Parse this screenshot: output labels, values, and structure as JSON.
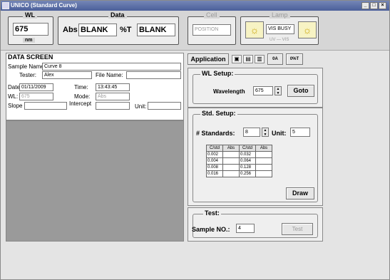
{
  "window": {
    "title": "UNICO (Standard Curve)",
    "controls": [
      "_",
      "□",
      "×"
    ]
  },
  "top": {
    "wl": {
      "label": "WL",
      "value": "675",
      "unit": "nm"
    },
    "data": {
      "label": "Data",
      "abs_label": "Abs",
      "abs_value": "BLANK",
      "t_label": "%T",
      "t_value": "BLANK"
    },
    "cell": {
      "label": "Cell",
      "position": "POSITION"
    },
    "lamp": {
      "label": "Lamp",
      "status": "VIS BUSY",
      "uv_vis": "UV — VIS"
    }
  },
  "data_screen": {
    "title": "DATA SCREEN",
    "sample_name_label": "Sample Name:",
    "sample_name": "Curve 8",
    "tester_label": "Tester:",
    "tester": "Alex",
    "file_name_label": "File Name:",
    "file_name": "",
    "date_label": "Date:",
    "date": "01/11/2009",
    "time_label": "Time:",
    "time": "13:43:45",
    "wl_label": "WL:",
    "wl": "675",
    "mode_label": "Mode:",
    "mode": "Abs",
    "slope_label": "Slope",
    "slope": "",
    "intercept_label": "Intercept",
    "intercept": "",
    "unit_label": "Unit:",
    "unit": ""
  },
  "application": {
    "label": "Application",
    "tools": [
      "save-icon",
      "open-icon",
      "print-icon"
    ],
    "buttons": [
      "0A",
      "0%T"
    ]
  },
  "wl_setup": {
    "title": "WL Setup:",
    "wavelength_label": "Wavelength",
    "wavelength": "675",
    "goto": "Goto"
  },
  "std_setup": {
    "title": "Std. Setup:",
    "standards_label": "# Standards:",
    "standards": "8",
    "unit_label": "Unit:",
    "unit": "5",
    "headers": [
      "C/std",
      "Abs",
      "C/std",
      "Abs"
    ],
    "rows": [
      [
        "0.002",
        "",
        "0.032",
        ""
      ],
      [
        "0.004",
        "",
        "0.064",
        ""
      ],
      [
        "0.008",
        "",
        "0.128",
        ""
      ],
      [
        "0.016",
        "",
        "0.256",
        ""
      ]
    ],
    "draw": "Draw"
  },
  "test": {
    "title": "Test:",
    "sample_no_label": "Sample NO.:",
    "sample_no": "4",
    "test_button": "Test"
  }
}
